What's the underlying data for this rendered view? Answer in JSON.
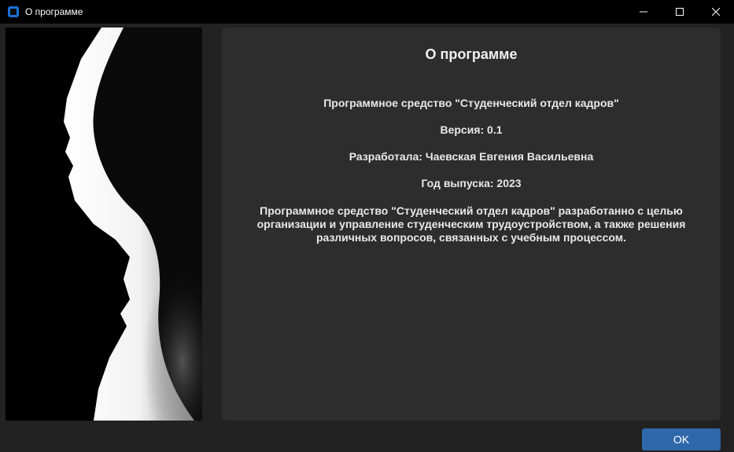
{
  "window": {
    "title": "О программе",
    "icon": "app-icon",
    "controls": [
      "minimize-icon",
      "maximize-icon",
      "close-icon"
    ]
  },
  "image": {
    "description_icon": "silhouette-portrait"
  },
  "about": {
    "heading": "О программе",
    "product": "Программное средство \"Студенческий отдел кадров\"",
    "version": "Версия: 0.1",
    "author": "Разработала: Чаевская Евгения Васильевна",
    "year": "Год выпуска: 2023",
    "description": "Программное средство \"Студенческий отдел кадров\" разработанно с целью организации и управление студенческим трудоустройством, а также решения различных вопросов, связанных с учебным процессом."
  },
  "buttons": {
    "ok": "OK"
  },
  "colors": {
    "titlebar": "#000000",
    "background": "#222222",
    "panel": "#2d2d2d",
    "accent": "#2f68aa"
  }
}
